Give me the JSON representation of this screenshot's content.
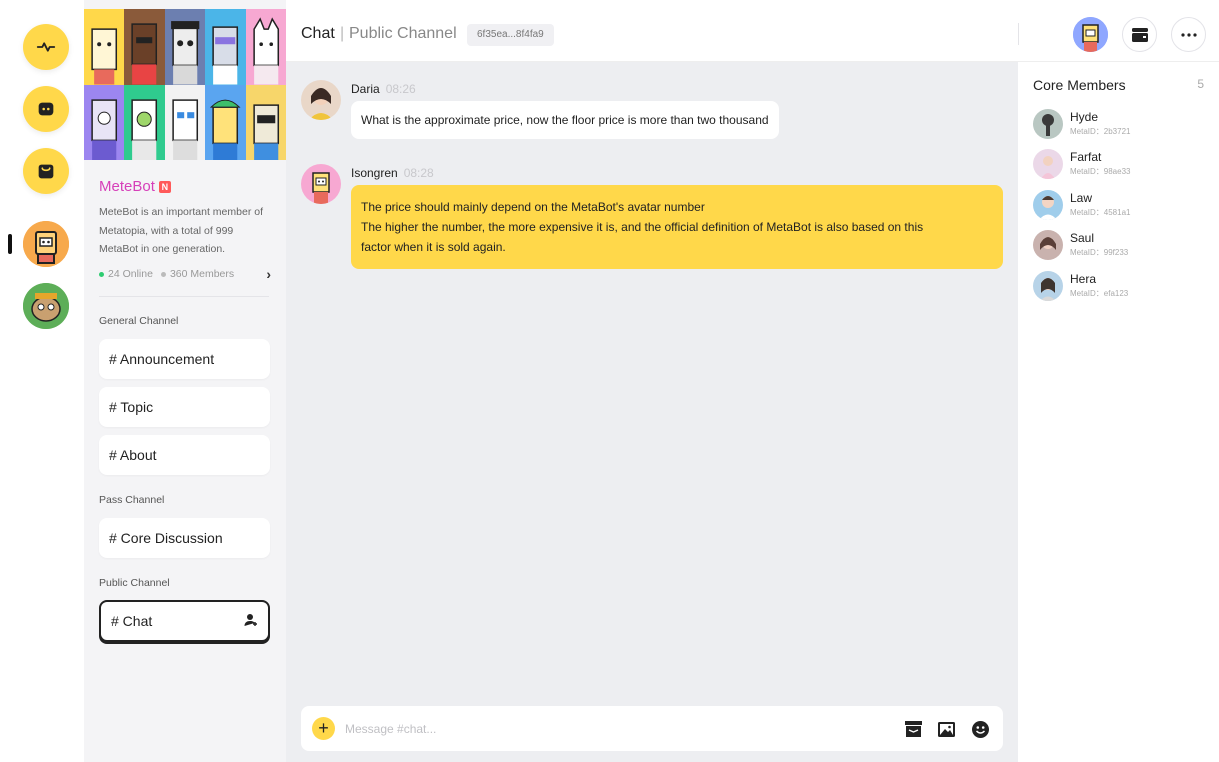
{
  "rail": {
    "items": [
      {
        "icon": "activity-icon"
      },
      {
        "icon": "chat-bubble-icon"
      },
      {
        "icon": "store-icon"
      }
    ],
    "communities": [
      "metebot-community-avatar",
      "green-community-avatar"
    ]
  },
  "community": {
    "name": "MeteBot",
    "badge": "N",
    "description": "MeteBot is an important member of Metatopia, with a total of 999 MetaBot in one generation.",
    "online": "24 Online",
    "members": "360 Members",
    "colors": {
      "name": "#D63FB9",
      "online_dot": "#2ECC71",
      "members_dot": "#BBBBBB",
      "accent": "#FFD84A"
    }
  },
  "channels": {
    "general_label": "General Channel",
    "general": [
      "# Announcement",
      "# Topic",
      "# About"
    ],
    "pass_label": "Pass Channel",
    "pass": [
      "# Core Discussion"
    ],
    "public_label": "Public Channel",
    "public": [
      "# Chat"
    ]
  },
  "header": {
    "title": "Chat",
    "separator": "|",
    "subtitle": "Public Channel",
    "channel_id": "6f35ea...8f4fa9"
  },
  "messages": [
    {
      "author": "Daria",
      "time": "08:26",
      "lines": [
        "What is the approximate price, now the floor price is more than two thousand"
      ]
    },
    {
      "author": "Isongren",
      "time": "08:28",
      "lines": [
        "The price should mainly depend on the MetaBot's avatar number",
        "The higher the number, the more expensive it is, and the official definition of MetaBot is also based on this",
        "factor when it is sold again."
      ]
    }
  ],
  "composer": {
    "placeholder": "Message #chat..."
  },
  "core_members": {
    "title": "Core Members",
    "count": "5",
    "list": [
      {
        "name": "Hyde",
        "meta_id": "MetaID：2b3721"
      },
      {
        "name": "Farfat",
        "meta_id": "MetaID：98ae33"
      },
      {
        "name": "Law",
        "meta_id": "MetaID：4581a1"
      },
      {
        "name": "Saul",
        "meta_id": "MetaID：99f233"
      },
      {
        "name": "Hera",
        "meta_id": "MetaID：efa123"
      }
    ]
  }
}
